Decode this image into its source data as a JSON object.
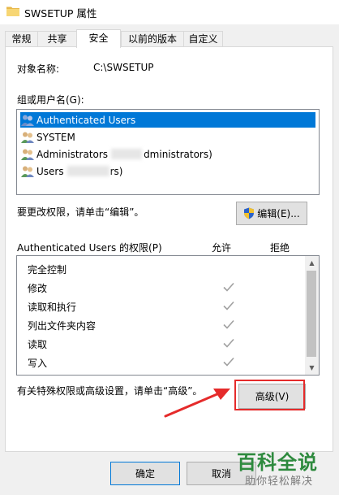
{
  "window": {
    "title": "SWSETUP 属性"
  },
  "tabs": [
    {
      "label": "常规"
    },
    {
      "label": "共享"
    },
    {
      "label": "安全"
    },
    {
      "label": "以前的版本"
    },
    {
      "label": "自定义"
    }
  ],
  "security": {
    "object_label": "对象名称:",
    "object_value": "C:\\SWSETUP",
    "group_label": "组或用户名(G):",
    "users": [
      {
        "name": "Authenticated Users",
        "selected": true
      },
      {
        "name": "SYSTEM"
      },
      {
        "name_prefix": "Administrators",
        "name_suffix": "dministrators)"
      },
      {
        "name_prefix": "Users",
        "name_suffix": "rs)"
      }
    ],
    "edit_hint": "要更改权限，请单击“编辑”。",
    "edit_button": "编辑(E)...",
    "perm_title": "Authenticated Users 的权限(P)",
    "allow_header": "允许",
    "deny_header": "拒绝",
    "permissions": [
      {
        "name": "完全控制",
        "allow": false
      },
      {
        "name": "修改",
        "allow": true
      },
      {
        "name": "读取和执行",
        "allow": true
      },
      {
        "name": "列出文件夹内容",
        "allow": true
      },
      {
        "name": "读取",
        "allow": true
      },
      {
        "name": "写入",
        "allow": true
      }
    ],
    "advanced_hint": "有关特殊权限或高级设置，请单击“高级”。",
    "advanced_button": "高级(V)"
  },
  "footer": {
    "ok_button": "确定",
    "cancel_button": "取消"
  },
  "watermark": {
    "big": "百科全说",
    "small": "助你轻松解决"
  },
  "colors": {
    "selection": "#0078d7",
    "highlight": "#e52b2b",
    "watermark": "#2e8a3e"
  }
}
